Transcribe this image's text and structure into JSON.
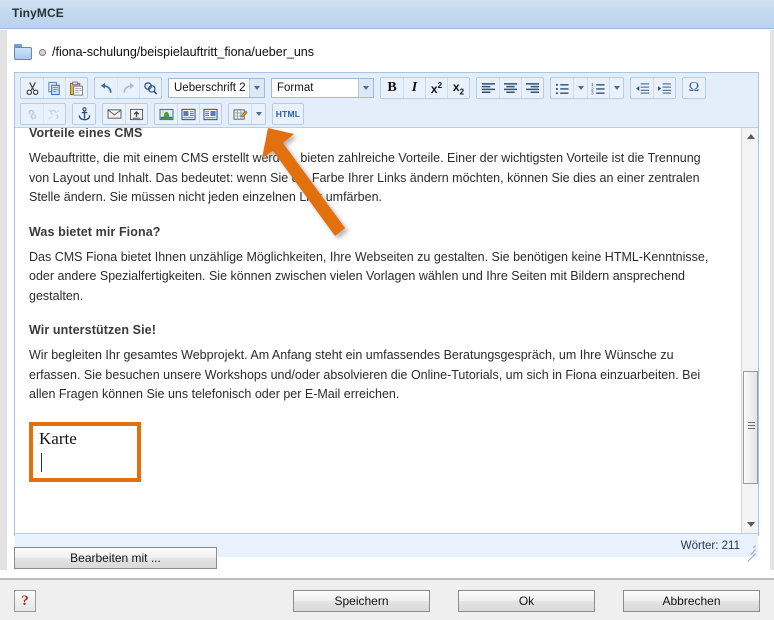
{
  "window": {
    "title": "TinyMCE"
  },
  "breadcrumb": {
    "folder_icon": "folder-icon",
    "path": "/fiona-schulung/beispielauftritt_fiona/ueber_uns"
  },
  "toolbar": {
    "row1": {
      "groups": [
        {
          "buttons": [
            {
              "name": "cut-icon",
              "title": "Ausschneiden",
              "disabled": false
            },
            {
              "name": "copy-icon",
              "title": "Kopieren",
              "disabled": false
            },
            {
              "name": "paste-icon",
              "title": "Einfügen",
              "disabled": false
            }
          ]
        },
        {
          "buttons": [
            {
              "name": "undo-icon",
              "title": "Rückgängig",
              "disabled": false
            },
            {
              "name": "redo-icon",
              "title": "Wiederholen",
              "disabled": true
            },
            {
              "name": "search-replace-icon",
              "title": "Suchen und Ersetzen",
              "disabled": false
            }
          ]
        }
      ],
      "selects": [
        {
          "name": "block-format-select",
          "value": "Ueberschrift 2"
        },
        {
          "name": "format-select",
          "value": "Format"
        }
      ],
      "groups_right": [
        {
          "buttons": [
            {
              "name": "bold-icon",
              "label": "B",
              "title": "Fett"
            },
            {
              "name": "italic-icon",
              "label": "I",
              "title": "Kursiv"
            },
            {
              "name": "superscript-icon",
              "label": "x²",
              "title": "Hochgestellt"
            },
            {
              "name": "subscript-icon",
              "label": "x₂",
              "title": "Tiefgestellt"
            }
          ]
        },
        {
          "buttons": [
            {
              "name": "align-left-icon",
              "title": "Linksbündig"
            },
            {
              "name": "align-center-icon",
              "title": "Zentriert"
            },
            {
              "name": "align-right-icon",
              "title": "Rechtsbündig"
            }
          ]
        },
        {
          "buttons": [
            {
              "name": "bullet-list-icon",
              "title": "Aufzählung"
            },
            {
              "name": "numbered-list-icon",
              "title": "Nummerierte Liste"
            }
          ]
        },
        {
          "buttons": [
            {
              "name": "outdent-icon",
              "title": "Ausrücken"
            },
            {
              "name": "indent-icon",
              "title": "Einrücken"
            }
          ]
        },
        {
          "buttons": [
            {
              "name": "special-char-icon",
              "label": "Ω",
              "title": "Sonderzeichen"
            }
          ]
        }
      ]
    },
    "row2": {
      "groups": [
        {
          "buttons": [
            {
              "name": "link-icon",
              "title": "Link einfügen",
              "disabled": true
            },
            {
              "name": "unlink-icon",
              "title": "Link entfernen",
              "disabled": true
            }
          ]
        },
        {
          "buttons": [
            {
              "name": "anchor-icon",
              "title": "Anker",
              "disabled": false
            }
          ]
        },
        {
          "buttons": [
            {
              "name": "mail-icon",
              "title": "E-Mail-Link",
              "disabled": false
            },
            {
              "name": "upload-icon",
              "title": "Datei hochladen",
              "disabled": false
            }
          ]
        },
        {
          "buttons": [
            {
              "name": "image-icon",
              "title": "Bild einfügen",
              "disabled": false
            },
            {
              "name": "media-left-icon",
              "title": "Medien links",
              "disabled": false
            },
            {
              "name": "media-right-icon",
              "title": "Medien rechts",
              "disabled": false
            }
          ]
        },
        {
          "buttons": [
            {
              "name": "table-icon",
              "title": "Tabelle",
              "disabled": false
            }
          ],
          "has_caret": true
        }
      ],
      "html_button": {
        "name": "html-source-button",
        "label": "HTML"
      }
    }
  },
  "content": {
    "clipped_heading": "Vorteile eines CMS",
    "blocks": [
      {
        "type": "paragraph",
        "text": "Webauftritte, die mit einem CMS erstellt werden, bieten zahlreiche Vorteile. Einer der wichtigsten Vorteile ist die Trennung von Layout und Inhalt. Das bedeutet: wenn Sie die Farbe Ihrer Links ändern möchten, können Sie dies an einer zentralen Stelle ändern. Sie müssen nicht jeden einzelnen Link umfärben."
      },
      {
        "type": "heading",
        "text": "Was bietet mir Fiona?"
      },
      {
        "type": "paragraph",
        "text": "Das CMS Fiona bietet Ihnen unzählige Möglichkeiten, Ihre Webseiten zu gestalten. Sie benötigen keine HTML-Kenntnisse, oder andere Spezialfertigkeiten. Sie können zwischen vielen Vorlagen wählen und Ihre Seiten mit Bildern ansprechend gestalten."
      },
      {
        "type": "heading",
        "text": "Wir unterstützen Sie!"
      },
      {
        "type": "paragraph",
        "text": "Wir begleiten Ihr gesamtes Webprojekt. Am Anfang steht ein umfassendes Beratungsgespräch, um Ihre Wünsche zu erfassen. Sie besuchen unsere Workshops und/oder absolvieren die Online-Tutorials, um sich in Fiona einzuarbeiten. Bei allen Fragen können Sie uns telefonisch oder per E-Mail erreichen."
      }
    ],
    "karte_box": {
      "text": "Karte",
      "border_color": "#e2700d"
    }
  },
  "scrollbar": {
    "up_arrow": "scroll-up-icon",
    "down_arrow": "scroll-down-icon",
    "thumb": "scroll-thumb"
  },
  "statusbar": {
    "word_count": "Wörter: 211"
  },
  "actions": {
    "edit_with": "Bearbeiten mit ...",
    "help": "?",
    "save": "Speichern",
    "ok": "Ok",
    "cancel": "Abbrechen"
  },
  "annotation": {
    "arrow_color": "#e2700d",
    "points_to": "html-source-button"
  }
}
